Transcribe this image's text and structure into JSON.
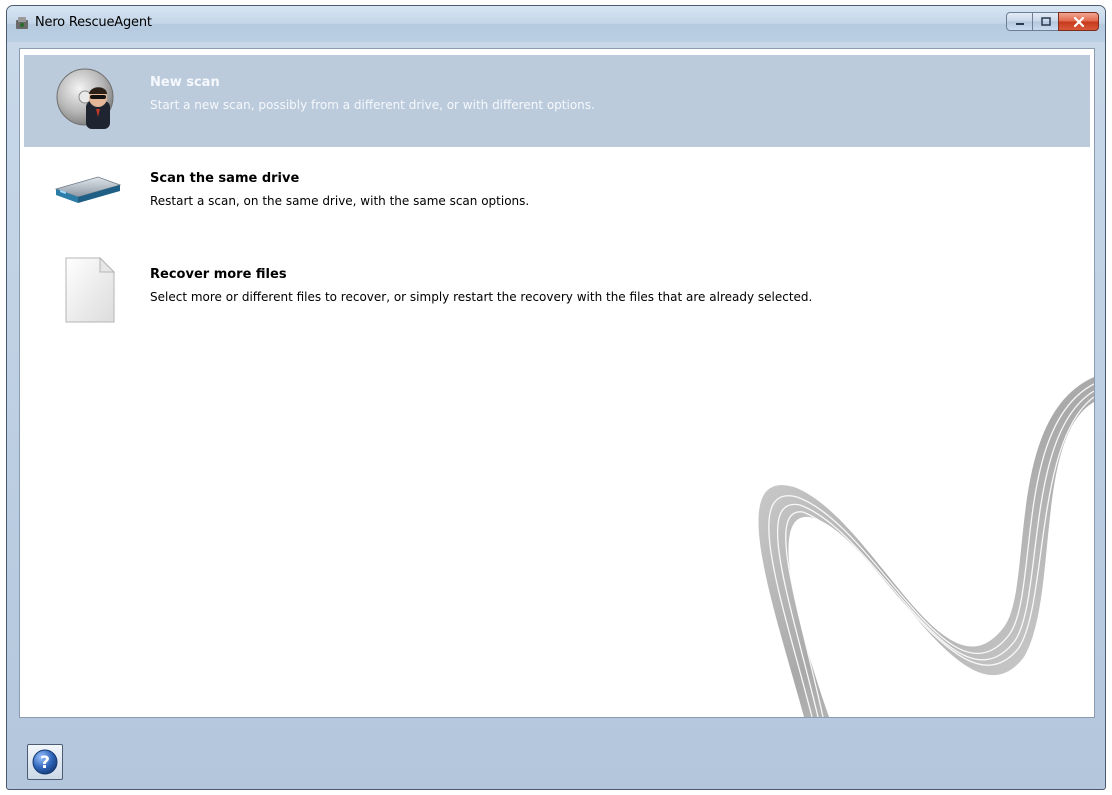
{
  "window": {
    "title": "Nero RescueAgent",
    "controls": [
      "minimize-icon",
      "maximize-icon",
      "close-icon"
    ]
  },
  "options": [
    {
      "label": "New scan",
      "description": "Start a new scan, possibly from a different drive, or with different options.",
      "icon": "new-scan-disc-icon",
      "selected": true
    },
    {
      "label": "Scan the same drive",
      "description": "Restart a scan, on the same drive, with the same scan options.",
      "icon": "hard-drive-icon",
      "selected": false
    },
    {
      "label": "Recover more files",
      "description": "Select more or different files to recover, or simply restart the recovery with the files that are already selected.",
      "icon": "document-icon",
      "selected": false
    }
  ],
  "footer": {
    "help_icon": "help-icon"
  },
  "colors": {
    "selection": "#bccbdc",
    "titlebar": "#c3d5e8",
    "close_button": "#d8583a",
    "help": "#2f65b9"
  }
}
